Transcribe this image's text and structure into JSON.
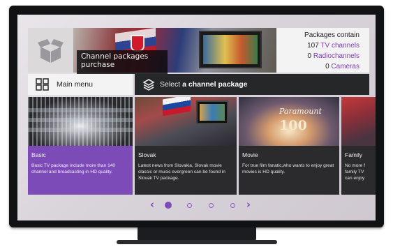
{
  "header": {
    "title": "Channel packages purchase",
    "info_title": "Packages contain",
    "counts": [
      {
        "num": "107",
        "label": "TV channels"
      },
      {
        "num": "0",
        "label": "Radiochannels"
      },
      {
        "num": "0",
        "label": "Cameras"
      }
    ]
  },
  "nav": {
    "main_menu": "Main menu",
    "select_prefix": "Select",
    "select_bold": "a channel package"
  },
  "cards": [
    {
      "name": "Basic",
      "desc": "Basic TV package include more than 140 channel and broadcasting in HD quality.",
      "selected": true
    },
    {
      "name": "Slovak",
      "desc": "Latest news from Slovakia, Slovak movie classic or music evergreen can be found in Slovak TV package."
    },
    {
      "name": "Movie",
      "desc": "For true film fanatic,who wants to enjoy great movies is HD quality."
    },
    {
      "name": "Family",
      "desc": "No more f family TV can enjoy"
    }
  ],
  "movie_logo": {
    "brand": "Paramount",
    "number": "100"
  },
  "pager": {
    "total_pages": 4,
    "current_page": 1,
    "prev": "‹",
    "next": "›"
  },
  "colors": {
    "accent": "#7d4bb8",
    "dark_bar": "#262729",
    "light_panel": "#f3f3f4"
  },
  "icons": [
    "box-icon",
    "main-menu-grid-icon",
    "layers-icon",
    "chevron-left-icon",
    "chevron-right-icon"
  ]
}
